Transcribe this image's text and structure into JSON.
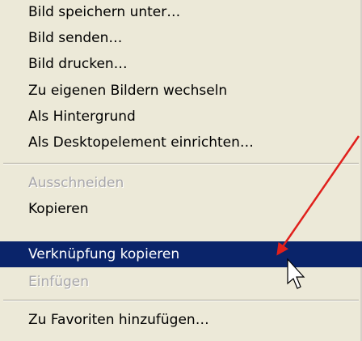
{
  "context_menu": {
    "items": [
      {
        "label": "Bild speichern unter…",
        "state": "enabled"
      },
      {
        "label": "Bild senden…",
        "state": "enabled"
      },
      {
        "label": "Bild drucken…",
        "state": "enabled"
      },
      {
        "label": "Zu eigenen Bildern wechseln",
        "state": "enabled"
      },
      {
        "label": "Als Hintergrund",
        "state": "enabled"
      },
      {
        "label": "Als Desktopelement einrichten…",
        "state": "enabled"
      },
      {
        "label": "Ausschneiden",
        "state": "disabled"
      },
      {
        "label": "Kopieren",
        "state": "enabled"
      },
      {
        "label": "Verknüpfung kopieren",
        "state": "highlighted"
      },
      {
        "label": "Einfügen",
        "state": "disabled"
      },
      {
        "label": "Zu Favoriten hinzufügen…",
        "state": "enabled"
      }
    ]
  },
  "annotation": {
    "arrow_color": "#e0201c",
    "cursor_icon": "mouse-pointer-icon"
  },
  "colors": {
    "menu_background": "#ece9d8",
    "highlight_background": "#0a246a",
    "highlight_text": "#ffffff",
    "disabled_text": "#a7a6aa"
  }
}
